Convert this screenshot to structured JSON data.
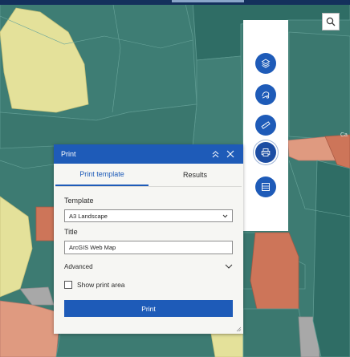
{
  "map": {
    "label_lower_right": "Ca"
  },
  "colors": {
    "accent": "#1e5bb8",
    "map_teal": "#3d7b72",
    "map_dark_teal": "#2f6d65",
    "map_yellow": "#e4e19a",
    "map_salmon": "#df9a80",
    "map_orange": "#cd7559",
    "map_gray": "#a8a8a8"
  },
  "search": {
    "icon": "search-icon"
  },
  "toolbar": {
    "tools": [
      {
        "name": "layers-icon"
      },
      {
        "name": "sketch-icon"
      },
      {
        "name": "measure-icon"
      },
      {
        "name": "print-icon",
        "active": true
      },
      {
        "name": "basemap-icon"
      }
    ]
  },
  "print_panel": {
    "title": "Print",
    "tabs": [
      {
        "label": "Print template",
        "active": true
      },
      {
        "label": "Results",
        "active": false
      }
    ],
    "template_label": "Template",
    "template_value": "A3 Landscape",
    "title_label": "Title",
    "title_value": "ArcGIS Web Map",
    "advanced_label": "Advanced",
    "show_print_area_label": "Show print area",
    "show_print_area_checked": false,
    "print_button_label": "Print"
  }
}
